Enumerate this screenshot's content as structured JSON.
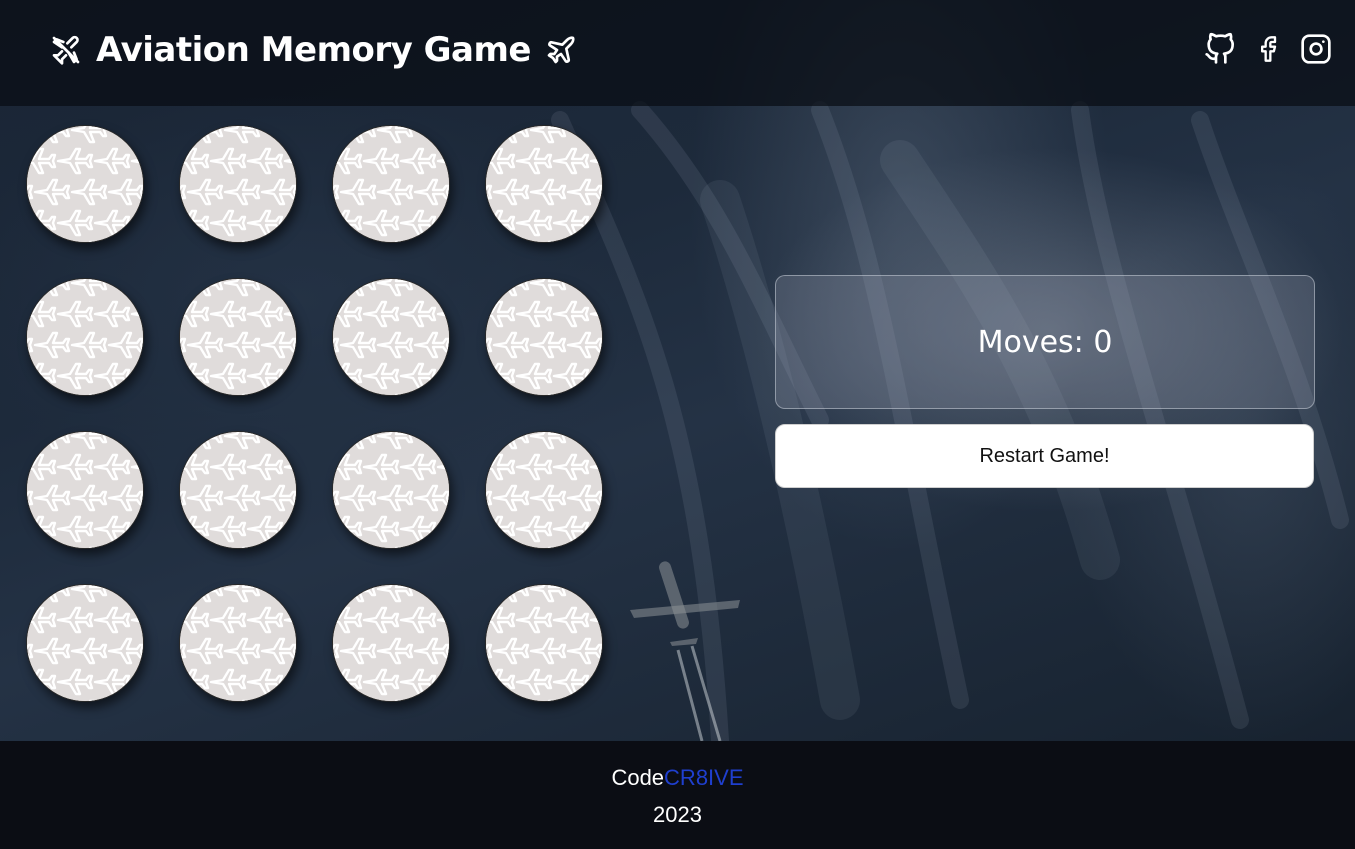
{
  "header": {
    "title": "Aviation Memory Game",
    "left_icon": "plane-slash-icon",
    "right_icon": "plane-icon",
    "socials": [
      {
        "name": "github",
        "icon": "github-icon"
      },
      {
        "name": "facebook",
        "icon": "facebook-icon"
      },
      {
        "name": "instagram",
        "icon": "instagram-icon"
      }
    ]
  },
  "board": {
    "rows": 4,
    "columns": 4,
    "card_count": 16,
    "card_back_pattern": "plane-pattern",
    "card_back_color": "#e0dcdb"
  },
  "scoreboard": {
    "moves_label": "Moves: 0"
  },
  "controls": {
    "restart_label": "Restart Game!"
  },
  "footer": {
    "brand_prefix": "Code",
    "brand_accent": "CR8IVE",
    "brand_accent_color": "#1f3fcf",
    "year": "2023"
  }
}
